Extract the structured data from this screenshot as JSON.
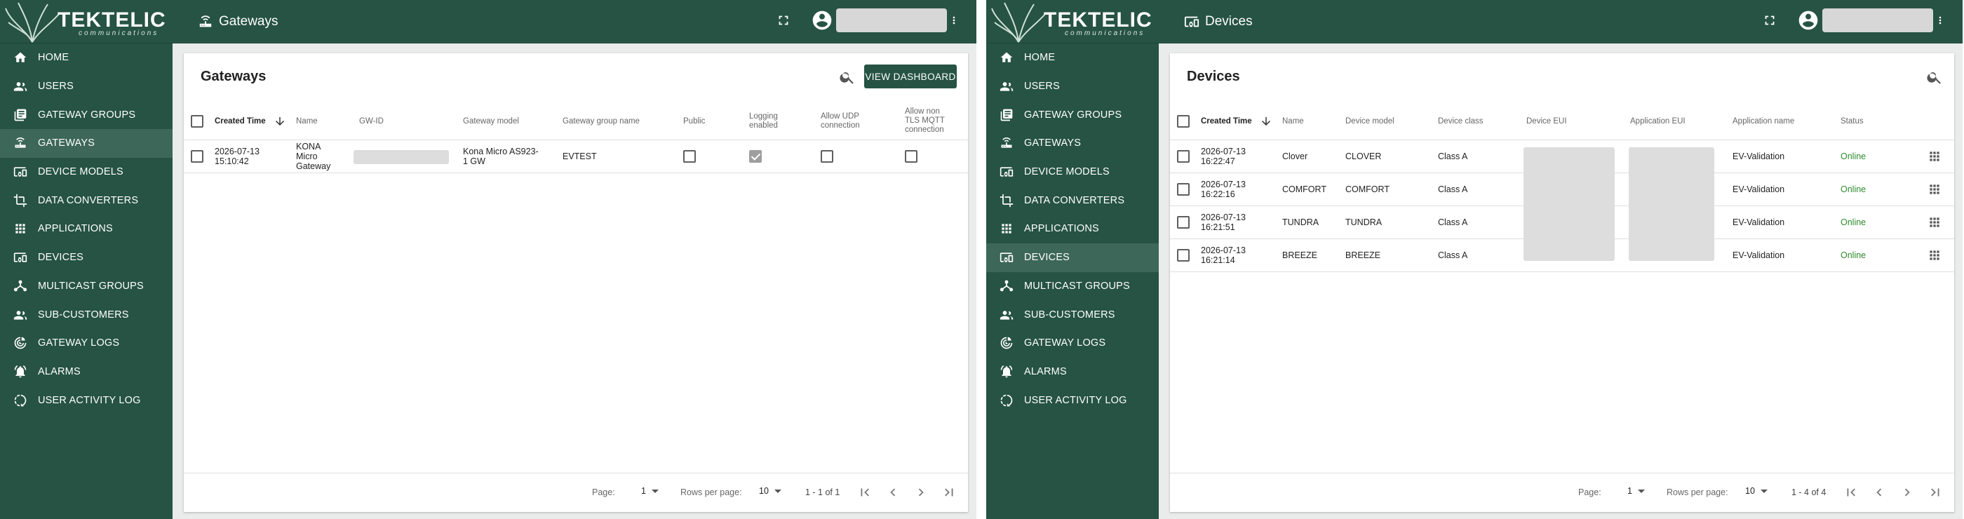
{
  "brand": {
    "name": "TEKTELIC",
    "sub": "communications"
  },
  "colors": {
    "primary": "#265343",
    "active_nav": "#3d6758",
    "online": "#2e8b2e"
  },
  "nav": [
    {
      "label": "HOME",
      "icon": "home-icon"
    },
    {
      "label": "USERS",
      "icon": "users-icon"
    },
    {
      "label": "GATEWAY GROUPS",
      "icon": "gateway-groups-icon"
    },
    {
      "label": "GATEWAYS",
      "icon": "gateway-icon"
    },
    {
      "label": "DEVICE MODELS",
      "icon": "device-models-icon"
    },
    {
      "label": "DATA CONVERTERS",
      "icon": "crop-icon"
    },
    {
      "label": "APPLICATIONS",
      "icon": "apps-icon"
    },
    {
      "label": "DEVICES",
      "icon": "devices-icon"
    },
    {
      "label": "MULTICAST GROUPS",
      "icon": "multicast-icon"
    },
    {
      "label": "SUB-CUSTOMERS",
      "icon": "sub-customers-icon"
    },
    {
      "label": "GATEWAY LOGS",
      "icon": "logs-icon"
    },
    {
      "label": "ALARMS",
      "icon": "alarm-icon"
    },
    {
      "label": "USER ACTIVITY LOG",
      "icon": "activity-icon"
    }
  ],
  "gateways": {
    "topbar_title": "Gateways",
    "card_title": "Gateways",
    "dashboard_button": "VIEW DASHBOARD",
    "columns": {
      "created": "Created Time",
      "name": "Name",
      "gwid": "GW-ID",
      "model": "Gateway model",
      "group": "Gateway group name",
      "public": "Public",
      "logging_1": "Logging",
      "logging_2": "enabled",
      "udp_1": "Allow UDP",
      "udp_2": "connection",
      "mqtt_1": "Allow non",
      "mqtt_2": "TLS MQTT",
      "mqtt_3": "connection"
    },
    "rows": [
      {
        "date": "2026-07-13",
        "time": "15:10:42",
        "name_1": "KONA",
        "name_2": "Micro",
        "name_3": "Gateway",
        "model_1": "Kona Micro AS923-",
        "model_2": "1 GW",
        "group": "EVTEST"
      }
    ],
    "footer": {
      "page_label": "Page:",
      "page_value": "1",
      "rows_label": "Rows per page:",
      "rows_value": "10",
      "range": "1 - 1 of 1"
    }
  },
  "devices": {
    "topbar_title": "Devices",
    "card_title": "Devices",
    "columns": {
      "created": "Created Time",
      "name": "Name",
      "model": "Device model",
      "class": "Device class",
      "eui": "Device EUI",
      "app_eui": "Application EUI",
      "app_name": "Application name",
      "status": "Status"
    },
    "rows": [
      {
        "date": "2026-07-13",
        "time": "16:22:47",
        "name": "Clover",
        "model": "CLOVER",
        "class": "Class A",
        "app_name": "EV-Validation",
        "status": "Online"
      },
      {
        "date": "2026-07-13",
        "time": "16:22:16",
        "name": "COMFORT",
        "model": "COMFORT",
        "class": "Class A",
        "app_name": "EV-Validation",
        "status": "Online"
      },
      {
        "date": "2026-07-13",
        "time": "16:21:51",
        "name": "TUNDRA",
        "model": "TUNDRA",
        "class": "Class A",
        "app_name": "EV-Validation",
        "status": "Online"
      },
      {
        "date": "2026-07-13",
        "time": "16:21:14",
        "name": "BREEZE",
        "model": "BREEZE",
        "class": "Class A",
        "app_name": "EV-Validation",
        "status": "Online"
      }
    ],
    "footer": {
      "page_label": "Page:",
      "page_value": "1",
      "rows_label": "Rows per page:",
      "rows_value": "10",
      "range": "1 - 4 of 4"
    }
  }
}
